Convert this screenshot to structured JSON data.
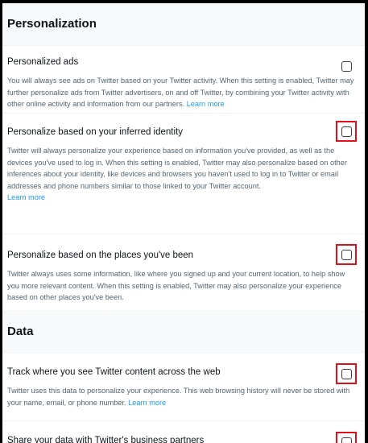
{
  "sections": [
    {
      "title": "Personalization",
      "settings": [
        {
          "title": "Personalized ads",
          "description": "You will always see ads on Twitter based on your Twitter activity. When this setting is enabled, Twitter may further personalize ads from Twitter advertisers, on and off Twitter, by combining your Twitter activity with other online activity and information from our partners.",
          "link": "Learn more",
          "checked": false,
          "highlighted": false
        },
        {
          "title": "Personalize based on your inferred identity",
          "description": "Twitter will always personalize your experience based on information you've provided, as well as the devices you've used to log in. When this setting is enabled, Twitter may also personalize based on other inferences about your identity, like devices and browsers you haven't used to log in to Twitter or email addresses and phone numbers similar to those linked to your Twitter account.",
          "link": "Learn more",
          "checked": false,
          "highlighted": true
        },
        {
          "title": "Personalize based on the places you've been",
          "description": "Twitter always uses some information, like where you signed up and your current location, to help show you more relevant content. When this setting is enabled, Twitter may also personalize your experience based on other places you've been.",
          "link": "",
          "checked": false,
          "highlighted": true
        }
      ]
    },
    {
      "title": "Data",
      "settings": [
        {
          "title": "Track where you see Twitter content across the web",
          "description": "Twitter uses this data to personalize your experience. This web browsing history will never be stored with your name, email, or phone number.",
          "link": "Learn more",
          "checked": false,
          "highlighted": true
        },
        {
          "title": "Share your data with Twitter's business partners",
          "description": "",
          "link": "",
          "checked": false,
          "highlighted": true
        }
      ]
    }
  ],
  "colors": {
    "highlight": "#e0101b",
    "link": "#1d9bf0",
    "header_bg": "#f7f9fa"
  }
}
